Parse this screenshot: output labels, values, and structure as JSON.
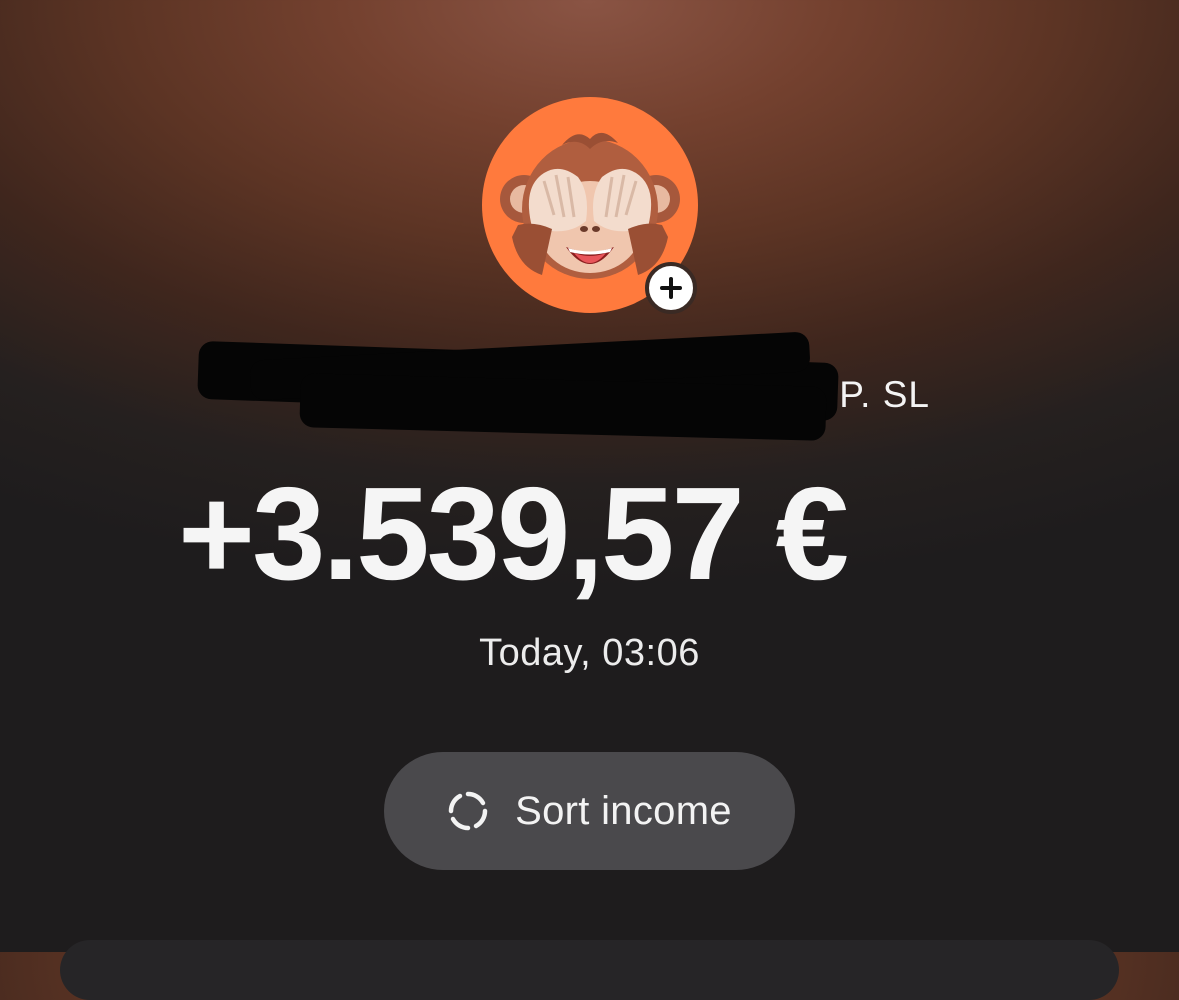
{
  "transaction": {
    "merchant_name_visible": "P. SL",
    "amount": "+3.539,57 €",
    "timestamp": "Today, 03:06"
  },
  "avatar": {
    "icon": "see-no-evil-monkey-icon",
    "background_color": "#ff7a3d",
    "badge_icon": "plus-icon"
  },
  "actions": {
    "sort_label": "Sort income",
    "sort_icon": "loading-circle-icon"
  },
  "colors": {
    "button_bg": "#4a494c",
    "text": "#f5f5f5"
  }
}
